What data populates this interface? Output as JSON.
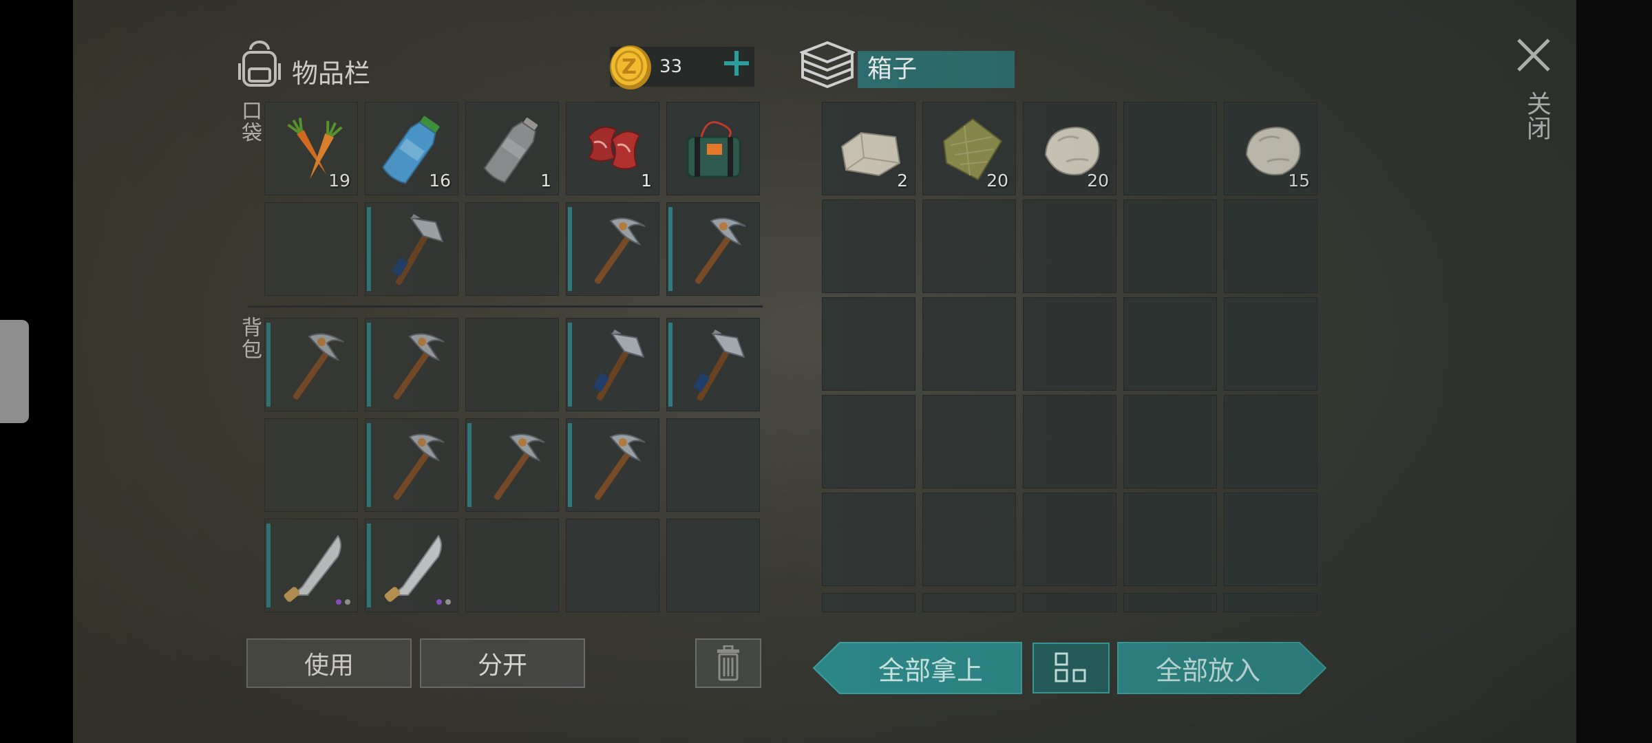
{
  "inventory": {
    "title": "物品栏",
    "coins": "33",
    "pocket_label": "口袋",
    "backpack_label": "背包",
    "pocket_items": [
      {
        "icon": "carrot-icon",
        "count": "19"
      },
      {
        "icon": "water-bottle-icon",
        "count": "16"
      },
      {
        "icon": "empty-bottle-icon",
        "count": "1"
      },
      {
        "icon": "raw-meat-icon",
        "count": "1"
      },
      {
        "icon": "explosive-icon",
        "count": ""
      },
      {
        "icon": "",
        "count": ""
      },
      {
        "icon": "hatchet-icon",
        "count": ""
      },
      {
        "icon": "",
        "count": ""
      },
      {
        "icon": "pickaxe-icon",
        "count": ""
      },
      {
        "icon": "pickaxe-icon",
        "count": ""
      }
    ],
    "backpack_items": [
      {
        "icon": "pickaxe-icon",
        "count": ""
      },
      {
        "icon": "pickaxe-icon",
        "count": ""
      },
      {
        "icon": "",
        "count": ""
      },
      {
        "icon": "hatchet-icon",
        "count": ""
      },
      {
        "icon": "hatchet-icon",
        "count": ""
      },
      {
        "icon": "",
        "count": ""
      },
      {
        "icon": "pickaxe-icon",
        "count": ""
      },
      {
        "icon": "pickaxe-icon",
        "count": ""
      },
      {
        "icon": "pickaxe-icon",
        "count": ""
      },
      {
        "icon": "",
        "count": ""
      },
      {
        "icon": "machete-icon",
        "count": ""
      },
      {
        "icon": "machete-icon",
        "count": ""
      },
      {
        "icon": "",
        "count": ""
      },
      {
        "icon": "",
        "count": ""
      },
      {
        "icon": "",
        "count": ""
      }
    ],
    "use_label": "使用",
    "split_label": "分开"
  },
  "box": {
    "title": "箱子",
    "items": [
      {
        "icon": "limestone-icon",
        "count": "2"
      },
      {
        "icon": "fabric-icon",
        "count": "20"
      },
      {
        "icon": "stone-icon",
        "count": "20"
      },
      {
        "icon": "",
        "count": ""
      },
      {
        "icon": "stone-icon",
        "count": "15"
      }
    ],
    "take_all_label": "全部拿上",
    "put_all_label": "全部放入"
  },
  "close_label": "关闭",
  "colors": {
    "accent": "#2e8a8a",
    "slot": "#313634",
    "tool_bar": "#2c7c80"
  }
}
